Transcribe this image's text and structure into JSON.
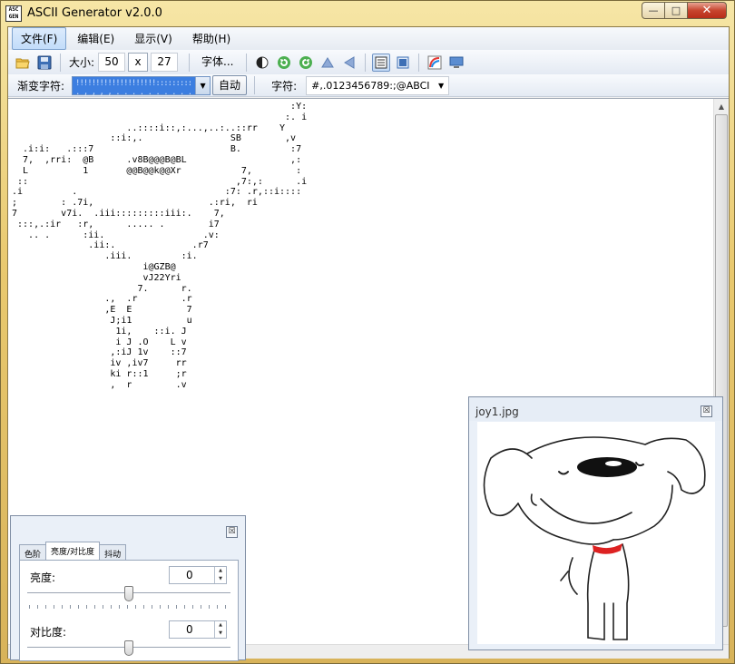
{
  "window": {
    "title": "ASCII Generator v2.0.0",
    "app_icon_text": "ASC\nGEN"
  },
  "menu": [
    "文件(F)",
    "编辑(E)",
    "显示(V)",
    "帮助(H)"
  ],
  "toolbar": {
    "size_label": "大小:",
    "width": "50",
    "x_label": "x",
    "height": "27",
    "font_button": "字体..."
  },
  "toolbar2": {
    "gradient_label": "渐变字符:",
    "gradient_value": "!!!!!!!!!!!!!!!!!!!!::::::::: ;. . , , , , . . . . . . . . . .",
    "auto_button": "自动",
    "chars_label": "字符:",
    "chars_value": "#,.0123456789:;@ABCI"
  },
  "ascii_art": "                                                   :Y:\n                                                  :. i\n                     ..::::i::,:...,..:..::rr    Y\n                  ::i:,.                SB        ,v\n  .i:i:   .:::7                         B.         :7\n  7,  ,rri:  @B      .v8B@@@B@BL                   ,:\n  L          1       @@B@@k@@Xr           7,        :\n ::                                      ,7:,:      .i\n.i         .                           :7: .r,::i::::\n;        : .7i,                     .:ri,  ri\n7        v7i.  .iii:::::::::iii:.    7,\n :::,.:ir   :r,      ..... .        i7\n   .. .      :ii.                  .v:\n              .ii:.              .r7\n                 .iii.         :i.\n                        i@GZB@\n                        vJ22Yri\n                       7.      r.\n                 .,  .r        .r\n                 ,E  E          7\n                  J;i1          u\n                   1i,    ::i. J\n                   i J .O    L v\n                  ,:iJ 1v    ::7\n                  iv ,iv7     rr\n                  ki r::1     ;r\n                  ,  r        .v",
  "image_window": {
    "title": "joy1.jpg"
  },
  "adjust_panel": {
    "tabs": [
      "色阶",
      "亮度/对比度",
      "抖动"
    ],
    "active_tab": "亮度/对比度",
    "brightness_label": "亮度:",
    "brightness_value": "0",
    "brightness_level": 0.5,
    "contrast_label": "对比度:",
    "contrast_value": "0",
    "contrast_level": 0.5
  },
  "icons": {
    "open": "open-folder-icon",
    "save": "save-icon",
    "invert": "invert-icon",
    "rotate_left": "rotate-left-icon",
    "rotate_right": "rotate-right-icon",
    "flip_v": "flip-vertical-icon",
    "flip_h": "flip-horizontal-icon",
    "view_text": "text-view-icon",
    "view_image": "image-view-icon",
    "color": "color-icon",
    "preview": "preview-icon"
  }
}
